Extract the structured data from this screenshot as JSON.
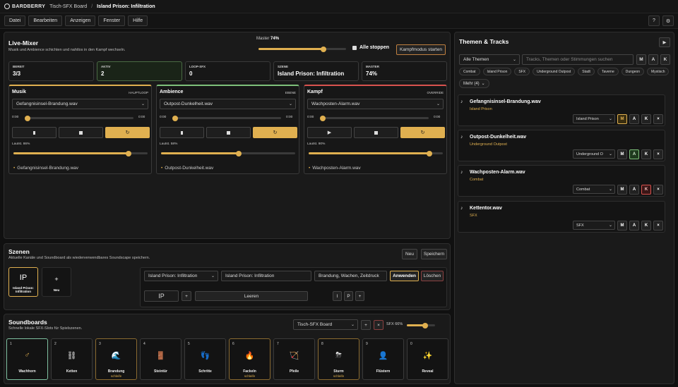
{
  "app": {
    "brand": "BARDBERRY",
    "board": "Tisch-SFX Board",
    "separator": "/",
    "scene": "Island Prison: Infiltration"
  },
  "menu": [
    "Datei",
    "Bearbeiten",
    "Anzeigen",
    "Fenster",
    "Hilfe"
  ],
  "top_icons": {
    "help": "?",
    "settings": "⚙"
  },
  "mixer": {
    "title": "Live-Mixer",
    "subtitle": "Musik und Ambience schichten und nahtlos in den Kampf wechseln.",
    "master_label": "Master",
    "master_value": "74%",
    "master_level": 0.74,
    "stop_all": "Alle stoppen",
    "combat_mode": "Kampfmodus starten",
    "stats": [
      {
        "label": "BEREIT",
        "value": "3/3"
      },
      {
        "label": "AKTIV",
        "value": "2"
      },
      {
        "label": "LOOP-SFX",
        "value": "0"
      },
      {
        "label": "SZENE",
        "value": "Island Prison: Infiltration"
      },
      {
        "label": "MASTER",
        "value": "74%"
      }
    ],
    "channels": [
      {
        "title": "Musik",
        "tag": "HAUPTLOOP",
        "file": "Gefangnisinsel-Brandung.wav",
        "t0": "0:00",
        "t1": "0:00",
        "volume_label": "Lautst. 86%",
        "volume": 0.86,
        "footer": "Gefangnisinsel-Brandung.wav",
        "color": "#e0b050"
      },
      {
        "title": "Ambience",
        "tag": "EBENE",
        "file": "Outpost-Dunkelheit.wav",
        "t0": "0:00",
        "t1": "0:00",
        "volume_label": "Lautst. 58%",
        "volume": 0.58,
        "footer": "Outpost-Dunkelheit.wav",
        "color": "#7ec07a"
      },
      {
        "title": "Kampf",
        "tag": "OVERRIDE",
        "file": "Wachposten-Alarm.wav",
        "t0": "0:00",
        "t1": "0:00",
        "volume_label": "Lautst. 90%",
        "volume": 0.9,
        "footer": "Wachposten-Alarm.wav",
        "color": "#d9534f"
      }
    ]
  },
  "scenes": {
    "title": "Szenen",
    "subtitle": "Aktuelle Kanäle und Soundboard als wiederverwendbares Soundscape speichern.",
    "new_btn": "Neu",
    "save_btn": "Speichern",
    "card_icon": "IP",
    "card_label": "Island Prison: Infiltration",
    "new_card_icon": "+",
    "new_card_label": "Neu",
    "select": "Island Prison: Infiltration",
    "name": "Island Prison: Infiltration",
    "tags": "Brandung, Wachen, Zeitdruck",
    "apply": "Anwenden",
    "delete": "Löschen",
    "ip_field": "IP",
    "plus": "+",
    "clear": "Leeren",
    "i": "I",
    "p": "P",
    "plus2": "+"
  },
  "soundboards": {
    "title": "Soundboards",
    "subtitle": "Schnelle lokale SFX-Slots für Spielszenen.",
    "board": "Tisch-SFX Board",
    "add": "+",
    "remove": "×",
    "sfx_label": "SFX 66%",
    "sfx_level": 0.66,
    "pads": [
      {
        "num": "1",
        "label": "Wachhorn",
        "aux": "",
        "icon": "♂",
        "active": true
      },
      {
        "num": "2",
        "label": "Ketten",
        "aux": "",
        "icon": "⛓"
      },
      {
        "num": "3",
        "label": "Brandung",
        "aux": "schleife",
        "icon": "🌊"
      },
      {
        "num": "4",
        "label": "Steintür",
        "aux": "",
        "icon": "🚪"
      },
      {
        "num": "5",
        "label": "Schritte",
        "aux": "",
        "icon": "👣"
      },
      {
        "num": "6",
        "label": "Fackeln",
        "aux": "schleife",
        "icon": "🔥"
      },
      {
        "num": "7",
        "label": "Pfeile",
        "aux": "",
        "icon": "🏹"
      },
      {
        "num": "8",
        "label": "Sturm",
        "aux": "schleife",
        "icon": "⛈"
      },
      {
        "num": "9",
        "label": "Flüstern",
        "aux": "",
        "icon": "👤"
      },
      {
        "num": "0",
        "label": "Reveal",
        "aux": "",
        "icon": "✨"
      }
    ]
  },
  "themes": {
    "title": "Themen & Tracks",
    "play": "▶",
    "filter": "Alle Themen",
    "search_placeholder": "Tracks, Themen oder Stimmungen suchen",
    "m": "M",
    "a": "A",
    "k": "K",
    "tags": [
      "Combat",
      "Island Prison",
      "SFX",
      "Underground Outpost",
      "Stadt",
      "Taverne",
      "Dungeon",
      "Mystisch"
    ],
    "more": "Mehr (4)",
    "tracks": [
      {
        "name": "Gefangnisinsel-Brandung.wav",
        "category": "Island Prison",
        "select": "Island Prison",
        "on": "M"
      },
      {
        "name": "Outpost-Dunkelheit.wav",
        "category": "Underground Outpost",
        "select": "Underground O",
        "on": "A"
      },
      {
        "name": "Wachposten-Alarm.wav",
        "category": "Combat",
        "select": "Combat",
        "on": "K"
      },
      {
        "name": "Kettentor.wav",
        "category": "SFX",
        "select": "SFX",
        "on": ""
      }
    ]
  }
}
